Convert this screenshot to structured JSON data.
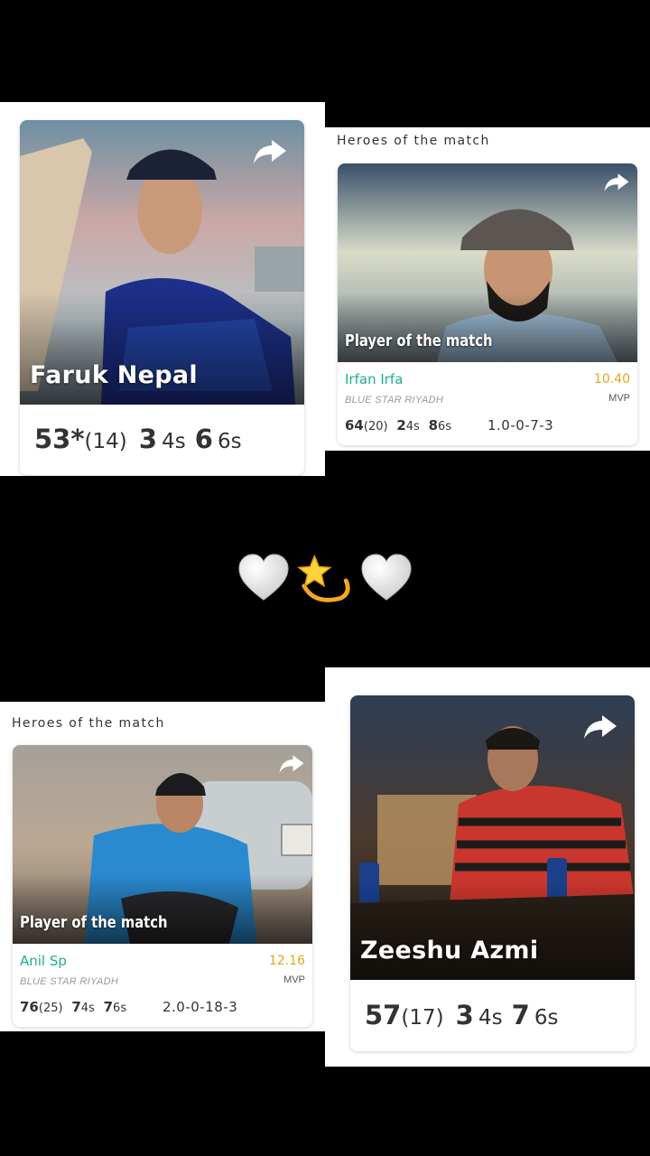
{
  "top_left": {
    "player_name": "Faruk Nepal",
    "runs": "53*",
    "balls": "(14)",
    "fours": "3",
    "fours_unit": "4s",
    "sixes": "6",
    "sixes_unit": "6s"
  },
  "top_right": {
    "section_title": "Heroes of the match",
    "award_label": "Player of the match",
    "player_name": "Irfan Irfa",
    "team": "BLUE STAR RIYADH",
    "points": "10.40",
    "points_label": "MVP",
    "runs": "64",
    "balls": "(20)",
    "fours": "2",
    "fours_unit": "4s",
    "sixes": "8",
    "sixes_unit": "6s",
    "bowling": "1.0-0-7-3"
  },
  "divider_emojis": [
    "white-heart-icon",
    "dizzy-star-icon",
    "white-heart-icon"
  ],
  "bottom_left": {
    "section_title": "Heroes of the match",
    "award_label": "Player of the match",
    "player_name": "Anil Sp",
    "team": "BLUE STAR RIYADH",
    "points": "12.16",
    "points_label": "MVP",
    "runs": "76",
    "balls": "(25)",
    "fours": "7",
    "fours_unit": "4s",
    "sixes": "7",
    "sixes_unit": "6s",
    "bowling": "2.0-0-18-3"
  },
  "bottom_right": {
    "player_name": "Zeeshu Azmi",
    "runs": "57",
    "balls": "(17)",
    "fours": "3",
    "fours_unit": "4s",
    "sixes": "7",
    "sixes_unit": "6s"
  },
  "colors": {
    "player_name_green": "#1cae8f",
    "points_orange": "#e3a51a",
    "background": "#000000"
  }
}
